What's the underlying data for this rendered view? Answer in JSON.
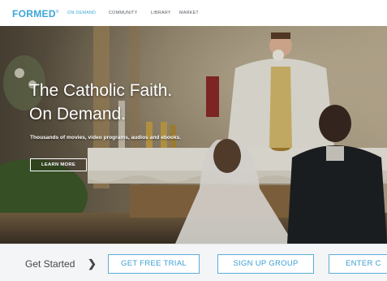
{
  "brand": {
    "logo_text": "FORMED",
    "trademark": "®",
    "accent_color": "#3aa6d6"
  },
  "nav": {
    "items": [
      {
        "label": "ON DEMAND",
        "active": true
      },
      {
        "label": "COMMUNITY",
        "active": false
      },
      {
        "label": "LIBRARY",
        "active": false
      },
      {
        "label": "MARKET",
        "active": false
      }
    ]
  },
  "hero": {
    "title_line1": "The Catholic Faith.",
    "title_line2": "On Demand.",
    "subtitle": "Thousands of movies, video programs, audios and ebooks.",
    "cta_label": "LEARN MORE"
  },
  "cta_bar": {
    "lead_text": "Get Started",
    "chevron": "❯",
    "buttons": [
      {
        "label": "GET FREE TRIAL"
      },
      {
        "label": "SIGN UP GROUP"
      },
      {
        "label": "ENTER C"
      }
    ]
  }
}
